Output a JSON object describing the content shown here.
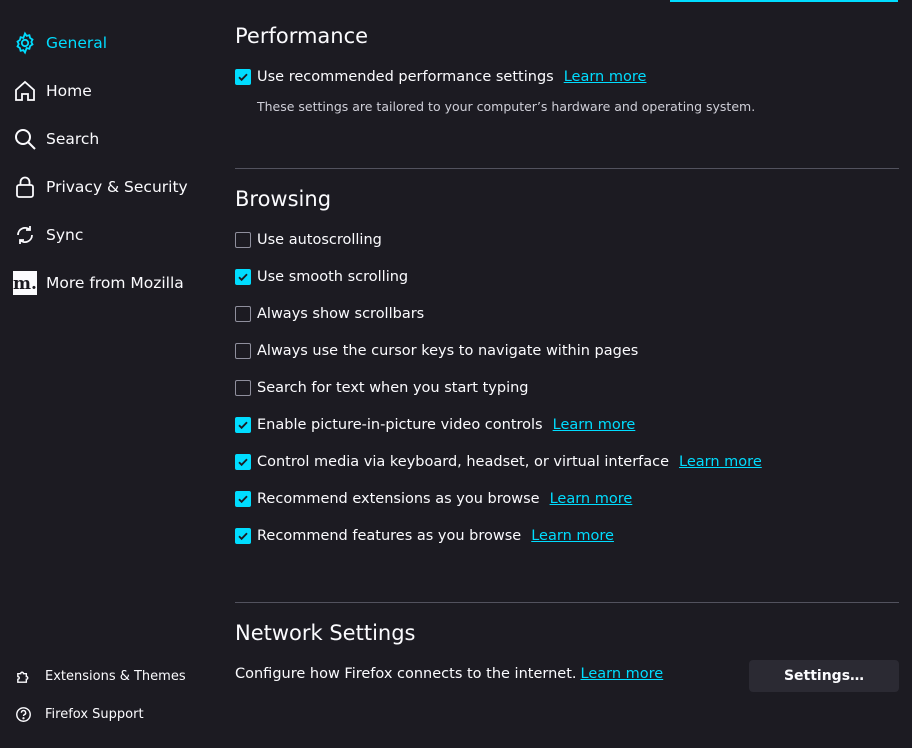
{
  "sidebar": {
    "items": [
      {
        "label": "General",
        "icon": "gear-icon",
        "selected": true
      },
      {
        "label": "Home",
        "icon": "home-icon",
        "selected": false
      },
      {
        "label": "Search",
        "icon": "search-icon",
        "selected": false
      },
      {
        "label": "Privacy & Security",
        "icon": "lock-icon",
        "selected": false
      },
      {
        "label": "Sync",
        "icon": "sync-icon",
        "selected": false
      },
      {
        "label": "More from Mozilla",
        "icon": "mozilla-icon",
        "selected": false
      }
    ],
    "footer": [
      {
        "label": "Extensions & Themes",
        "icon": "puzzle-icon"
      },
      {
        "label": "Firefox Support",
        "icon": "help-icon"
      }
    ]
  },
  "performance": {
    "heading": "Performance",
    "recommended_label": "Use recommended performance settings",
    "recommended_checked": true,
    "learn_more": "Learn more",
    "description": "These settings are tailored to your computer’s hardware and operating system."
  },
  "browsing": {
    "heading": "Browsing",
    "options": [
      {
        "label": "Use autoscrolling",
        "checked": false,
        "learn_more": ""
      },
      {
        "label": "Use smooth scrolling",
        "checked": true,
        "learn_more": ""
      },
      {
        "label": "Always show scrollbars",
        "checked": false,
        "learn_more": ""
      },
      {
        "label": "Always use the cursor keys to navigate within pages",
        "checked": false,
        "learn_more": ""
      },
      {
        "label": "Search for text when you start typing",
        "checked": false,
        "learn_more": ""
      },
      {
        "label": "Enable picture-in-picture video controls",
        "checked": true,
        "learn_more": "Learn more"
      },
      {
        "label": "Control media via keyboard, headset, or virtual interface",
        "checked": true,
        "learn_more": "Learn more"
      },
      {
        "label": "Recommend extensions as you browse",
        "checked": true,
        "learn_more": "Learn more"
      },
      {
        "label": "Recommend features as you browse",
        "checked": true,
        "learn_more": "Learn more"
      }
    ]
  },
  "network": {
    "heading": "Network Settings",
    "description": "Configure how Firefox connects to the internet.",
    "learn_more": "Learn more",
    "button_label": "Settings…"
  },
  "colors": {
    "accent": "#00ddff",
    "background": "#1c1b22",
    "button": "#2b2a33"
  }
}
